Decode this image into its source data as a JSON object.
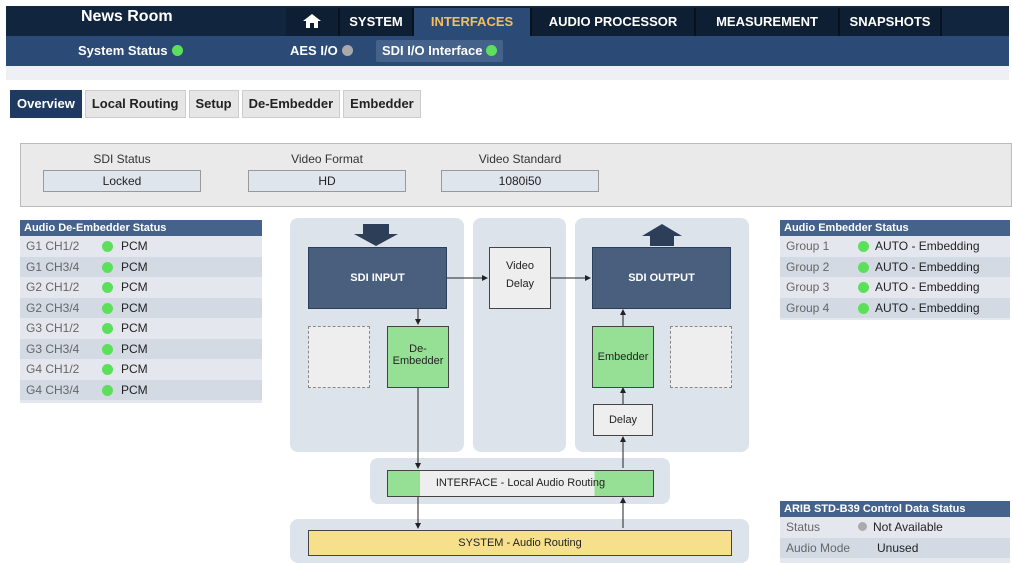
{
  "header": {
    "title": "News Room",
    "nav": [
      "SYSTEM",
      "INTERFACES",
      "AUDIO PROCESSOR",
      "MEASUREMENT",
      "SNAPSHOTS"
    ],
    "active_nav": "INTERFACES"
  },
  "subnav": {
    "system_status": "System Status",
    "aes_io": "AES I/O",
    "sdi_io": "SDI I/O Interface"
  },
  "tabs": [
    "Overview",
    "Local Routing",
    "Setup",
    "De-Embedder",
    "Embedder"
  ],
  "sdi_status": {
    "status_label": "SDI Status",
    "status_value": "Locked",
    "format_label": "Video Format",
    "format_value": "HD",
    "standard_label": "Video Standard",
    "standard_value": "1080i50"
  },
  "deembedder": {
    "title": "Audio De-Embedder Status",
    "rows": [
      {
        "ch": "G1 CH1/2",
        "v": "PCM"
      },
      {
        "ch": "G1 CH3/4",
        "v": "PCM"
      },
      {
        "ch": "G2 CH1/2",
        "v": "PCM"
      },
      {
        "ch": "G2 CH3/4",
        "v": "PCM"
      },
      {
        "ch": "G3 CH1/2",
        "v": "PCM"
      },
      {
        "ch": "G3 CH3/4",
        "v": "PCM"
      },
      {
        "ch": "G4 CH1/2",
        "v": "PCM"
      },
      {
        "ch": "G4 CH3/4",
        "v": "PCM"
      }
    ]
  },
  "embedder": {
    "title": "Audio Embedder Status",
    "rows": [
      {
        "g": "Group 1",
        "v": "AUTO - Embedding"
      },
      {
        "g": "Group 2",
        "v": "AUTO - Embedding"
      },
      {
        "g": "Group 3",
        "v": "AUTO - Embedding"
      },
      {
        "g": "Group 4",
        "v": "AUTO - Embedding"
      }
    ]
  },
  "arib": {
    "title": "ARIB STD-B39 Control Data Status",
    "status_label": "Status",
    "status_value": "Not Available",
    "mode_label": "Audio Mode",
    "mode_value": "Unused"
  },
  "diagram": {
    "sdi_input": "SDI INPUT",
    "video_delay_1": "Video",
    "video_delay_2": "Delay",
    "sdi_output": "SDI OUTPUT",
    "deembedder_1": "De-",
    "deembedder_2": "Embedder",
    "embedder": "Embedder",
    "delay": "Delay",
    "interface_routing": "INTERFACE - Local Audio Routing",
    "system_routing": "SYSTEM - Audio Routing"
  },
  "colors": {
    "ok": "#5ce05c",
    "inactive": "#aaaaaa",
    "accent": "#f0c060"
  }
}
